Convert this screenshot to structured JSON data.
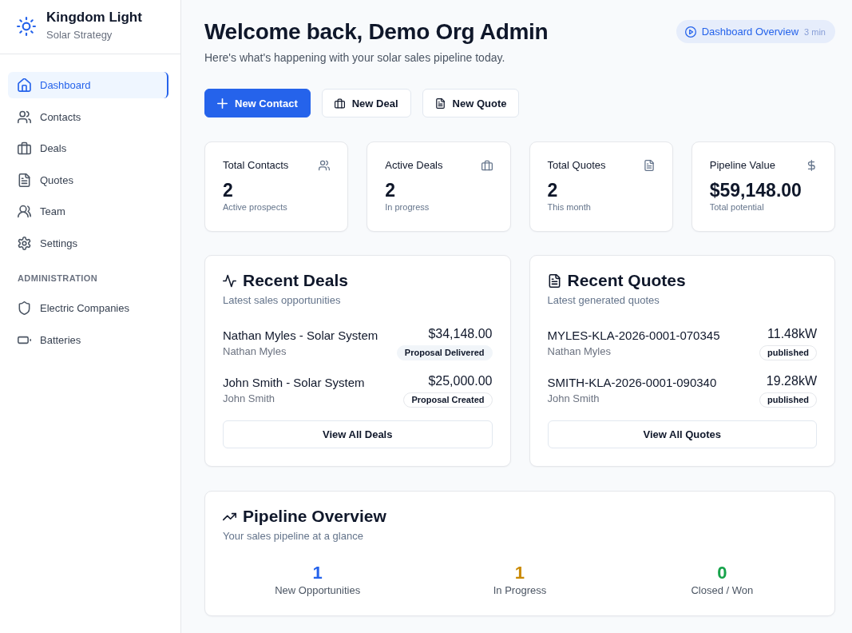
{
  "sidebar": {
    "brand": {
      "title": "Kingdom Light",
      "subtitle": "Solar Strategy"
    },
    "nav": [
      {
        "label": "Dashboard",
        "selected": true
      },
      {
        "label": "Contacts",
        "selected": false
      },
      {
        "label": "Deals",
        "selected": false
      },
      {
        "label": "Quotes",
        "selected": false
      },
      {
        "label": "Team",
        "selected": false
      },
      {
        "label": "Settings",
        "selected": false
      }
    ],
    "admin": {
      "heading": "ADMINISTRATION",
      "items": [
        {
          "label": "Electric Companies",
          "selected": false
        },
        {
          "label": "Batteries",
          "selected": false
        }
      ]
    }
  },
  "header": {
    "title": "Welcome back, Demo Org Admin",
    "subtitle": "Here's what's happening with your solar sales pipeline today.",
    "tour": {
      "label": "Dashboard Overview",
      "duration": "3 min"
    }
  },
  "actions": [
    {
      "label": "New Contact",
      "kind": "primary"
    },
    {
      "label": "New Deal",
      "kind": "outline"
    },
    {
      "label": "New Quote",
      "kind": "outline"
    }
  ],
  "stats": [
    {
      "title": "Total Contacts",
      "value": "2",
      "caption": "Active prospects"
    },
    {
      "title": "Active Deals",
      "value": "2",
      "caption": "In progress"
    },
    {
      "title": "Total Quotes",
      "value": "2",
      "caption": "This month"
    },
    {
      "title": "Pipeline Value",
      "value": "$59,148.00",
      "caption": "Total potential"
    }
  ],
  "recent_deals": {
    "title": "Recent Deals",
    "subtitle": "Latest sales opportunities",
    "rows": [
      {
        "kind": "filled",
        "name": "Nathan Myles - Solar System",
        "contact": "Nathan Myles",
        "amount": "$34,148.00",
        "status": "Proposal Delivered"
      },
      {
        "kind": "outline",
        "name": "John Smith - Solar System",
        "contact": "John Smith",
        "amount": "$25,000.00",
        "status": "Proposal Created"
      }
    ],
    "button": "View All Deals"
  },
  "recent_quotes": {
    "title": "Recent Quotes",
    "subtitle": "Latest generated quotes",
    "rows": [
      {
        "number": "MYLES-KLA-2026-0001-070345",
        "customer": "Nathan Myles",
        "size": "11.48kW",
        "status": "published"
      },
      {
        "number": "SMITH-KLA-2026-0001-090340",
        "customer": "John Smith",
        "size": "19.28kW",
        "status": "published"
      }
    ],
    "button": "View All Quotes"
  },
  "pipeline": {
    "title": "Pipeline Overview",
    "subtitle": "Your sales pipeline at a glance",
    "stages": [
      {
        "count": "1",
        "label": "New Opportunities",
        "color": "#2563eb"
      },
      {
        "count": "1",
        "label": "In Progress",
        "color": "#ca8a04"
      },
      {
        "count": "0",
        "label": "Closed / Won",
        "color": "#16a34a"
      }
    ]
  }
}
